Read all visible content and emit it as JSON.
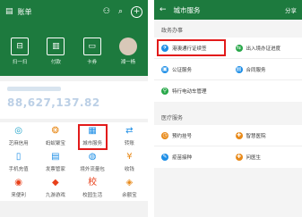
{
  "left": {
    "title": "账单",
    "topbar_icons": [
      "contacts-icon",
      "search-icon",
      "plus-icon"
    ],
    "quick_actions": [
      {
        "label": "扫一扫",
        "icon": "scan-icon"
      },
      {
        "label": "付款",
        "icon": "barcode-icon"
      },
      {
        "label": "卡券",
        "icon": "card-icon"
      },
      {
        "label": "湘一杨",
        "icon": "avatar-icon"
      }
    ],
    "balance": "88,627,137.82",
    "grid": [
      {
        "label": "芝麻信用",
        "icon": "sesame-icon",
        "color": "#1aa0c8",
        "glyph": "◎"
      },
      {
        "label": "蚂蚁聚宝",
        "icon": "treasure-icon",
        "color": "#e88a1a",
        "glyph": "❂"
      },
      {
        "label": "城市服务",
        "icon": "city-service-icon",
        "color": "#1d8ee6",
        "glyph": "▦"
      },
      {
        "label": "转账",
        "icon": "transfer-icon",
        "color": "#1d8ee6",
        "glyph": "⇄"
      },
      {
        "label": "手机充值",
        "icon": "phone-recharge-icon",
        "color": "#1d8ee6",
        "glyph": "▯"
      },
      {
        "label": "发票管家",
        "icon": "invoice-icon",
        "color": "#1d8ee6",
        "glyph": "▤"
      },
      {
        "label": "境外流量包",
        "icon": "roaming-icon",
        "color": "#1d8ee6",
        "glyph": "◍"
      },
      {
        "label": "收钱",
        "icon": "receive-money-icon",
        "color": "#e88a1a",
        "glyph": "¥"
      },
      {
        "label": "来便利",
        "icon": "convenience-icon",
        "color": "#e8401a",
        "glyph": "◉"
      },
      {
        "label": "九游游戏",
        "icon": "game-icon",
        "color": "#e8401a",
        "glyph": "◆"
      },
      {
        "label": "校园生活",
        "icon": "campus-icon",
        "color": "#e8401a",
        "glyph": "校"
      },
      {
        "label": "余额宝",
        "icon": "yuebao-icon",
        "color": "#e88a1a",
        "glyph": "◈"
      }
    ]
  },
  "right": {
    "title": "城市服务",
    "share": "分享",
    "sections": [
      {
        "title": "政务办事",
        "rows": [
          [
            {
              "label": "港澳通行证续签",
              "icon": "passport-icon",
              "color": "#1d8ee6",
              "glyph": "✈"
            },
            {
              "label": "出入境办证进度",
              "icon": "exit-entry-icon",
              "color": "#29a84a",
              "glyph": "⇆"
            }
          ],
          [
            {
              "label": "公证服务",
              "icon": "notary-icon",
              "color": "#1d8ee6",
              "glyph": "▣"
            },
            {
              "label": "合同服务",
              "icon": "contract-icon",
              "color": "#1d8ee6",
              "glyph": "▤"
            }
          ],
          [
            {
              "label": "特行电动车管理",
              "icon": "ebike-icon",
              "color": "#29a84a",
              "glyph": "⚲"
            }
          ]
        ]
      },
      {
        "title": "医疗服务",
        "rows": [
          [
            {
              "label": "预约挂号",
              "icon": "appointment-icon",
              "color": "#e88a1a",
              "glyph": "◷"
            },
            {
              "label": "智慧医院",
              "icon": "smart-hospital-icon",
              "color": "#e88a1a",
              "glyph": "✚"
            }
          ],
          [
            {
              "label": "疫苗接种",
              "icon": "vaccine-icon",
              "color": "#1d8ee6",
              "glyph": "✎"
            },
            {
              "label": "问医生",
              "icon": "ask-doctor-icon",
              "color": "#e88a1a",
              "glyph": "✚"
            }
          ]
        ]
      }
    ]
  }
}
